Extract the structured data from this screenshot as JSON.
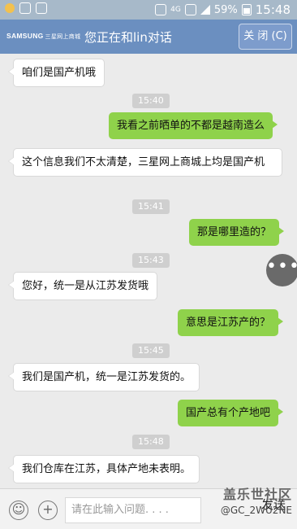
{
  "status_bar": {
    "battery": "59%",
    "time": "15:48",
    "network": "4G"
  },
  "header": {
    "brand": "SAMSUNG",
    "brand_sub": "三星网上商城",
    "title": "您正在和lin对话",
    "close_label": "关 闭 (C)"
  },
  "messages": [
    {
      "type": "in",
      "text": "咱们是国产机哦"
    },
    {
      "type": "time",
      "text": "15:40"
    },
    {
      "type": "out",
      "text": "我看之前晒单的不都是越南造么"
    },
    {
      "type": "in",
      "text": "这个信息我们不太清楚，三星网上商城上均是国产机"
    },
    {
      "type": "time",
      "text": "15:41"
    },
    {
      "type": "out",
      "text": "那是哪里造的？"
    },
    {
      "type": "time",
      "text": "15:43"
    },
    {
      "type": "in",
      "text": "您好，统一是从江苏发货哦"
    },
    {
      "type": "out",
      "text": "意思是江苏产的？"
    },
    {
      "type": "time",
      "text": "15:45"
    },
    {
      "type": "in",
      "text": "我们是国产机，统一是江苏发货的。"
    },
    {
      "type": "out",
      "text": "国产总有个产地吧"
    },
    {
      "type": "time",
      "text": "15:48"
    },
    {
      "type": "in",
      "text": "我们仓库在江苏，具体产地未表明。"
    }
  ],
  "more_button": "•••",
  "input": {
    "placeholder": "请在此输入问题. . . .",
    "send_label": "发送"
  },
  "watermark": {
    "line1": "盖乐世社区",
    "line2": "@GC_2WU2NE"
  }
}
